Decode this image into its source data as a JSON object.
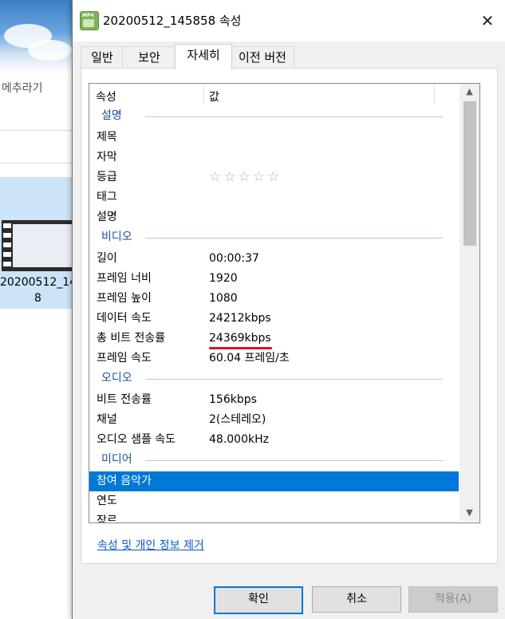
{
  "background": {
    "ribbon_text": "메추라기",
    "file_name_line1": "20200512_14",
    "file_name_line2": "8"
  },
  "dialog": {
    "title": "20200512_145858 속성",
    "icon_badge": "MP4",
    "close_glyph": "✕",
    "tabs": [
      {
        "label": "일반",
        "active": false
      },
      {
        "label": "보안",
        "active": false
      },
      {
        "label": "자세히",
        "active": true
      },
      {
        "label": "이전 버전",
        "active": false
      }
    ],
    "list": {
      "header_name": "속성",
      "header_value": "값",
      "scroll_up": "▲",
      "scroll_down": "▼",
      "rows": [
        {
          "type": "section",
          "name": "설명"
        },
        {
          "type": "prop",
          "name": "제목",
          "value": ""
        },
        {
          "type": "prop",
          "name": "자막",
          "value": ""
        },
        {
          "type": "prop",
          "name": "등급",
          "value": "☆☆☆☆☆",
          "stars": true
        },
        {
          "type": "prop",
          "name": "태그",
          "value": ""
        },
        {
          "type": "prop",
          "name": "설명",
          "value": ""
        },
        {
          "type": "section",
          "name": "비디오"
        },
        {
          "type": "prop",
          "name": "길이",
          "value": "00:00:37"
        },
        {
          "type": "prop",
          "name": "프레임 너비",
          "value": "1920"
        },
        {
          "type": "prop",
          "name": "프레임 높이",
          "value": "1080"
        },
        {
          "type": "prop",
          "name": "데이터 속도",
          "value": "24212kbps"
        },
        {
          "type": "prop",
          "name": "총 비트 전송률",
          "value": "24369kbps",
          "highlight": true
        },
        {
          "type": "prop",
          "name": "프레임 속도",
          "value": "60.04 프레임/초"
        },
        {
          "type": "section",
          "name": "오디오"
        },
        {
          "type": "prop",
          "name": "비트 전송률",
          "value": "156kbps"
        },
        {
          "type": "prop",
          "name": "채널",
          "value": "2(스테레오)"
        },
        {
          "type": "prop",
          "name": "오디오 샘플 속도",
          "value": "48.000kHz"
        },
        {
          "type": "section",
          "name": "미디어"
        },
        {
          "type": "prop",
          "name": "참여 음악가",
          "value": "",
          "selected": true
        },
        {
          "type": "prop",
          "name": "연도",
          "value": ""
        },
        {
          "type": "prop",
          "name": "장르",
          "value": ""
        }
      ]
    },
    "remove_link": "속성 및 개인 정보 제거",
    "buttons": {
      "ok": "확인",
      "cancel": "취소",
      "apply": "적용(A)"
    },
    "colors": {
      "selection": "#0078d7",
      "section_text": "#1a4f9c",
      "annotation": "#d4171e"
    }
  }
}
